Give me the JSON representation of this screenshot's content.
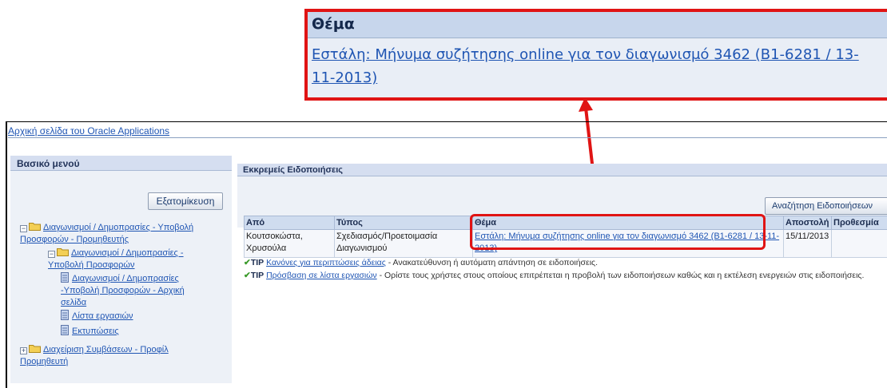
{
  "app": {
    "title": "Αρχική σελίδα του Oracle Applications"
  },
  "callout": {
    "header": "Θέμα",
    "link_text": "Εστάλη: Μήνυμα συζήτησης online για τον διαγωνισμό 3462 (B1-6281 / 13-11-2013)"
  },
  "menu": {
    "header": "Βασικό μενού",
    "personalize_label": "Εξατομίκευση",
    "tree": [
      {
        "level": 0,
        "expander": "−",
        "kind": "folder",
        "lines": [
          "Διαγωνισμοί / Δημοπρασίες - Υποβολή",
          "Προσφορών - Προμηθευτής"
        ]
      },
      {
        "level": 1,
        "expander": "−",
        "kind": "folder",
        "lines": [
          "Διαγωνισμοί / Δημοπρασίες -",
          "Υποβολή Προσφορών"
        ]
      },
      {
        "level": 2,
        "kind": "doc",
        "lines": [
          "Διαγωνισμοί / Δημοπρασίες",
          "-Υποβολή Προσφορών - Αρχική",
          "σελίδα"
        ]
      },
      {
        "level": 2,
        "kind": "doc",
        "lines": [
          "Λίστα εργασιών"
        ]
      },
      {
        "level": 2,
        "kind": "doc",
        "lines": [
          "Εκτυπώσεις"
        ]
      },
      {
        "level": 0,
        "expander": "+",
        "kind": "folder",
        "lines": [
          "Διαχείριση Συμβάσεων - Προφίλ",
          "Προμηθευτή"
        ]
      }
    ]
  },
  "notifications": {
    "header": "Εκκρεμείς Ειδοποιήσεις",
    "search_label": "Αναζήτηση Ειδοποιήσεων",
    "columns": {
      "from": "Από",
      "type": "Τύπος",
      "subject": "Θέμα",
      "sent": "Αποστολή",
      "due": "Προθεσμία"
    },
    "rows": [
      {
        "from": "Κουτσοκώστα, Χρυσούλα",
        "type": "Σχεδιασμός/Προετοιμασία Διαγωνισμού",
        "subject": "Εστάλη: Μήνυμα συζήτησης online για τον διαγωνισμό 3462 (B1-6281 / 13-11-2013)",
        "sent": "15/11/2013",
        "due": ""
      }
    ],
    "tips": [
      {
        "label": "TIP",
        "link": "Κανόνες για περιπτώσεις άδειας",
        "text": " - Ανακατεύθυνση ή αυτόματη απάντηση σε ειδοποιήσεις."
      },
      {
        "label": "TIP",
        "link": "Πρόσβαση σε λίστα εργασιών",
        "text": " - Ορίστε τους χρήστες στους οποίους επιτρέπεται η προβολή των ειδοποιήσεων καθώς και η εκτέλεση ενεργειών στις ειδοποιήσεις."
      }
    ]
  },
  "colors": {
    "highlight": "#e01414",
    "link": "#1f55b3",
    "header_bg": "#d5def0"
  }
}
